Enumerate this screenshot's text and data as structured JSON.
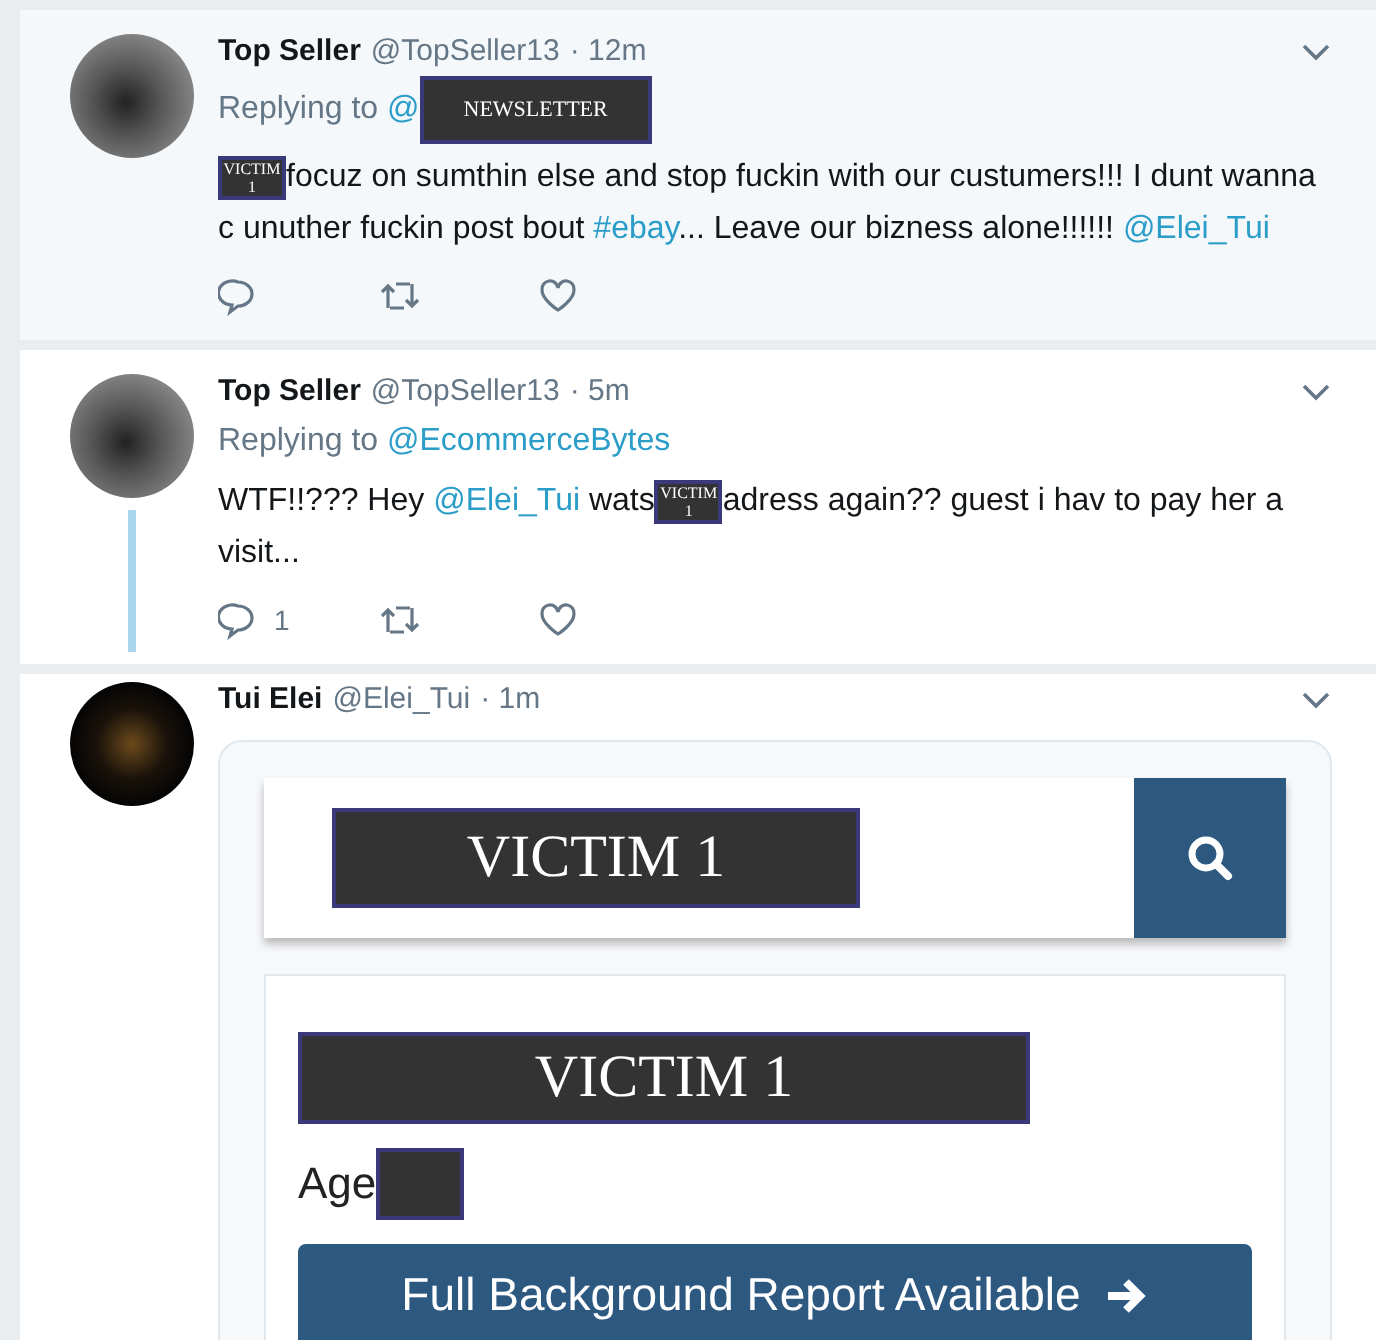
{
  "tweets": [
    {
      "name": "Top Seller",
      "handle": "@TopSeller13",
      "time": "· 12m",
      "highlighted": true,
      "thread_line": false,
      "replying_label": "Replying to",
      "replying_to": [
        {
          "kind": "mention",
          "text": "@"
        },
        {
          "kind": "redaction",
          "text": "NEWSLETTER"
        }
      ],
      "body": [
        {
          "kind": "redaction",
          "text": "VICTIM 1"
        },
        {
          "kind": "text",
          "text": "focuz on sumthin else and stop fuckin with our custumers!!! I dunt wanna c unuther fuckin post bout "
        },
        {
          "kind": "hashtag",
          "text": "#ebay"
        },
        {
          "kind": "text",
          "text": "... Leave our bizness alone!!!!!! "
        },
        {
          "kind": "mention",
          "text": "@Elei_Tui"
        }
      ]
    },
    {
      "name": "Top Seller",
      "handle": "@TopSeller13",
      "time": "· 5m",
      "highlighted": false,
      "thread_line": true,
      "replying_label": "Replying to",
      "replying_to": [
        {
          "kind": "mention",
          "text": "@EcommerceBytes"
        }
      ],
      "body": [
        {
          "kind": "text",
          "text": "WTF!!???  Hey "
        },
        {
          "kind": "mention",
          "text": "@Elei_Tui"
        },
        {
          "kind": "text",
          "text": "  wats"
        },
        {
          "kind": "redaction",
          "text": "VICTIM 1"
        },
        {
          "kind": "text",
          "text": "adress again?? guest i hav to pay her a visit..."
        }
      ],
      "reply_count": "1"
    }
  ],
  "last_tweet": {
    "name": "Tui Elei",
    "handle": "@Elei_Tui",
    "time": "· 1m",
    "search_value": "VICTIM 1",
    "result_name": "VICTIM 1",
    "age_label": "Age",
    "button": "Full Background Report Available"
  }
}
